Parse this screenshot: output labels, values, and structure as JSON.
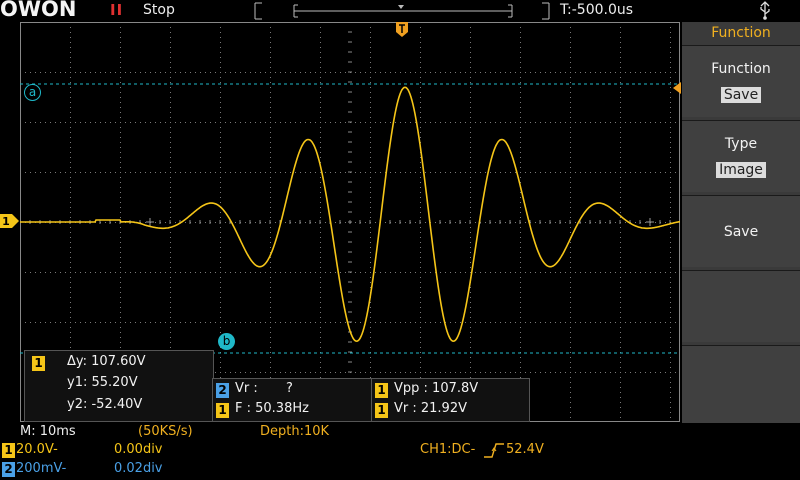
{
  "topbar": {
    "logo": "OWON",
    "run_icon": "II",
    "run_state": "Stop",
    "trigger_position": "T:-500.0us"
  },
  "sidebar": {
    "title": "Function",
    "buttons": [
      {
        "label": "Function",
        "value": "Save"
      },
      {
        "label": "Type",
        "value": "Image"
      },
      {
        "label": "Save",
        "value": ""
      },
      {
        "label": "",
        "value": ""
      },
      {
        "label": "",
        "value": ""
      }
    ]
  },
  "cursor_markers": {
    "a": "a",
    "b": "b"
  },
  "cursor_readout": {
    "channel": "1",
    "delta_y": "Δy: 107.60V",
    "y1": "y1: 55.20V",
    "y2": "y2: -52.40V"
  },
  "measurements": {
    "ch2_vr_label": "Vr :",
    "ch2_vr_value": "?",
    "ch1_freq": "F : 50.38Hz",
    "ch1_vpp": "Vpp : 107.8V",
    "ch1_vr": "Vr : 21.92V"
  },
  "timebase": {
    "main": "M: 10ms",
    "sample_rate": "(50KS/s)",
    "depth": "Depth:10K"
  },
  "channels": [
    {
      "id": "1",
      "scale": "20.0V-",
      "offset": "0.00div",
      "color": "#f5c518"
    },
    {
      "id": "2",
      "scale": "200mV-",
      "offset": "0.02div",
      "color": "#4aa0e6"
    }
  ],
  "trigger": {
    "source": "CH1:DC-",
    "level": "52.4V"
  },
  "colors": {
    "ch1": "#f5c518",
    "ch2": "#4aa0e6",
    "cursor": "#1fb8c8",
    "accent": "#f0b020",
    "run": "#e03030"
  },
  "waveform": {
    "frequency_hz": 50.38,
    "vpp_v": 107.8,
    "y1_v": 55.2,
    "y2_v": -52.4,
    "volts_per_div": 20.0,
    "ms_per_div": 10
  }
}
